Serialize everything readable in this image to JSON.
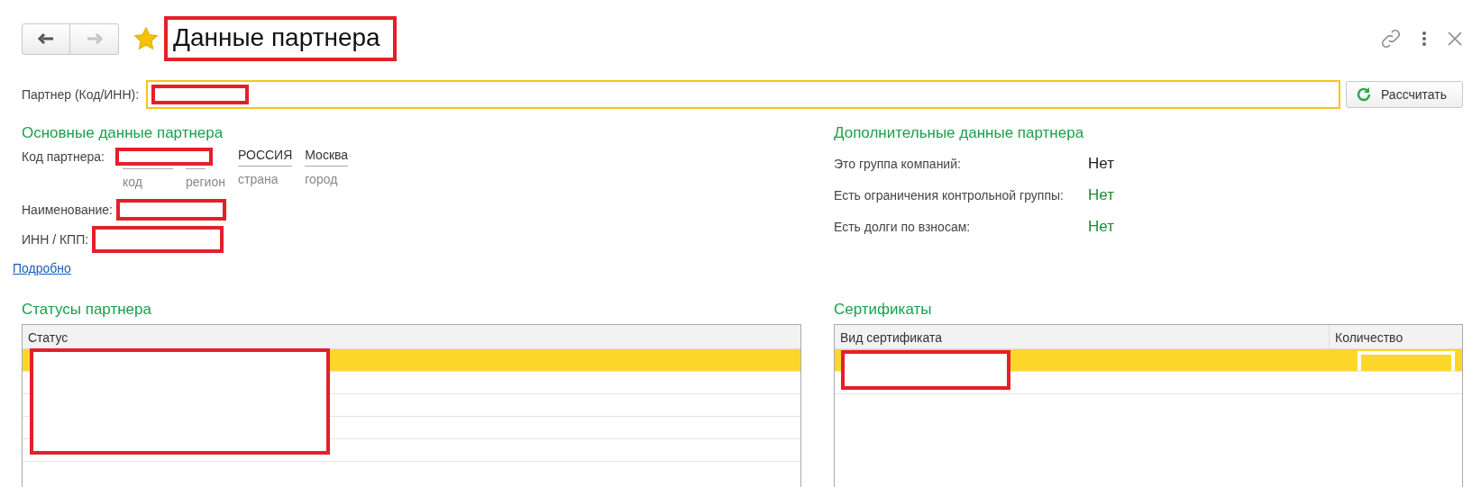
{
  "nav": {
    "back_disabled": false,
    "forward_disabled": true
  },
  "window": {
    "title": "Данные партнера",
    "favorite": true
  },
  "partner_field": {
    "label": "Партнер (Код/ИНН):"
  },
  "calculate_button": {
    "label": "Рассчитать"
  },
  "main_data": {
    "heading": "Основные данные партнера",
    "code_label": "Код партнера:",
    "code_parts": [
      {
        "caption": "код"
      },
      {
        "caption": "регион"
      },
      {
        "value": "РОССИЯ",
        "caption": "страна"
      },
      {
        "value": "Москва",
        "caption": "город"
      }
    ],
    "name_label": "Наименование:",
    "inn_label": "ИНН / КПП:",
    "details_link": "Подробно"
  },
  "extra_data": {
    "heading": "Дополнительные данные партнера",
    "items": [
      {
        "label": "Это группа компаний:",
        "value": "Нет",
        "color": "#222222"
      },
      {
        "label": "Есть ограничения контрольной группы:",
        "value": "Нет",
        "color": "#1e8a2e"
      },
      {
        "label": "Есть долги по взносам:",
        "value": "Нет",
        "color": "#1e8a2e"
      }
    ]
  },
  "statuses": {
    "heading": "Статусы партнера",
    "columns": [
      "Статус"
    ],
    "rows": [
      {
        "selected": true
      },
      {
        "selected": false
      },
      {
        "selected": false
      },
      {
        "selected": false
      },
      {
        "selected": false
      }
    ]
  },
  "certificates": {
    "heading": "Сертификаты",
    "columns": [
      "Вид сертификата",
      "Количество"
    ],
    "rows": [
      {
        "selected": true
      },
      {
        "selected": false
      }
    ]
  }
}
